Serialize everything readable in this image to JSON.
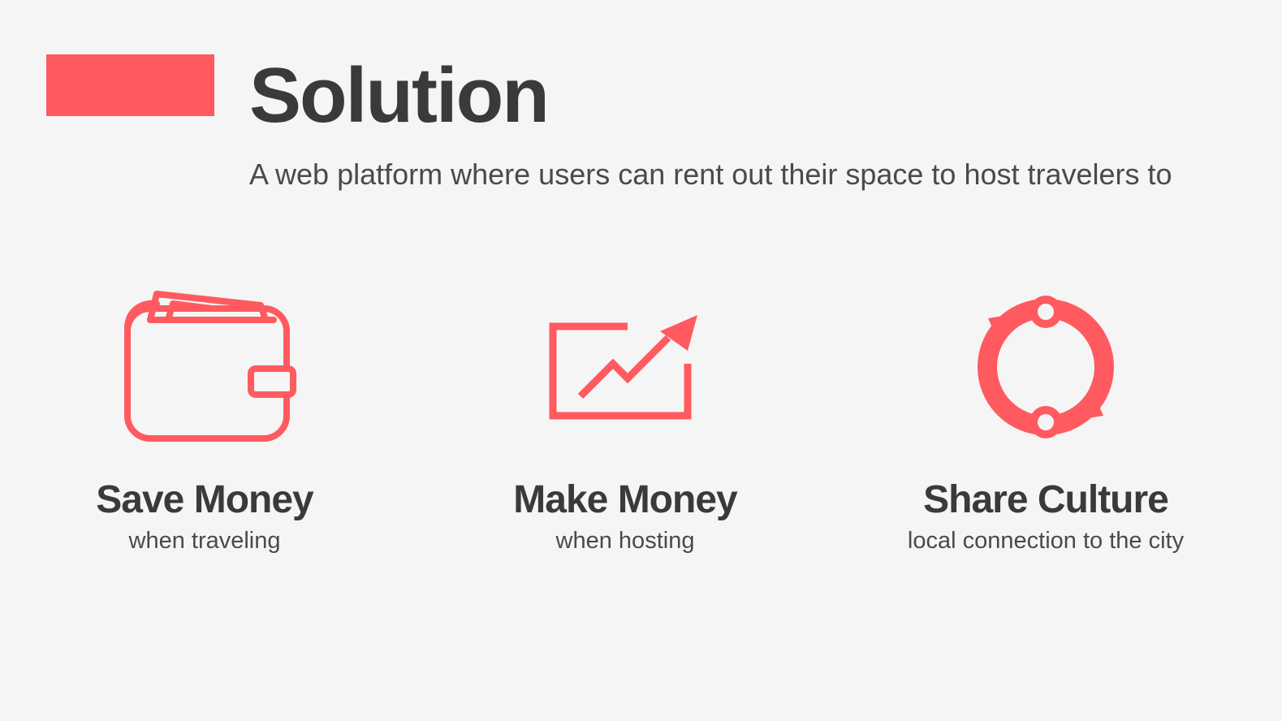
{
  "slide": {
    "title": "Solution",
    "subtitle": "A web platform where users can rent out their space to host travelers to",
    "accent_color": "#ff5a5f"
  },
  "features": [
    {
      "icon": "wallet-icon",
      "title": "Save Money",
      "description": "when traveling"
    },
    {
      "icon": "growth-chart-icon",
      "title": "Make Money",
      "description": "when hosting"
    },
    {
      "icon": "cycle-arrows-icon",
      "title": "Share Culture",
      "description": "local connection to the city"
    }
  ]
}
